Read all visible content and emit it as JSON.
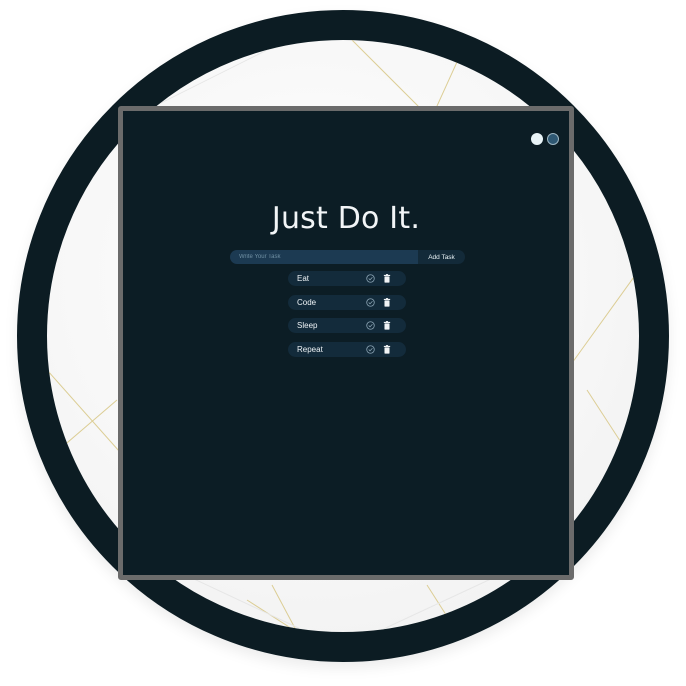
{
  "app": {
    "title": "Just Do It."
  },
  "theme": {
    "options": [
      {
        "name": "light",
        "color": "#e9f4f8"
      },
      {
        "name": "dark",
        "color": "#2f5873"
      }
    ],
    "selected": "dark"
  },
  "form": {
    "placeholder": "Write Your Task",
    "value": "",
    "add_label": "Add Task"
  },
  "todos": [
    {
      "label": "Eat"
    },
    {
      "label": "Code"
    },
    {
      "label": "Sleep"
    },
    {
      "label": "Repeat"
    }
  ],
  "icons": {
    "check": "check-circle-icon",
    "trash": "trash-icon"
  },
  "colors": {
    "background": "#0c1d25",
    "frame": "#6b6b6b",
    "ring": "#0c1c23",
    "input": "#1c3a52",
    "item": "#132b3b",
    "text": "#f2f5f7",
    "gold_accent": "#d9c98a"
  }
}
